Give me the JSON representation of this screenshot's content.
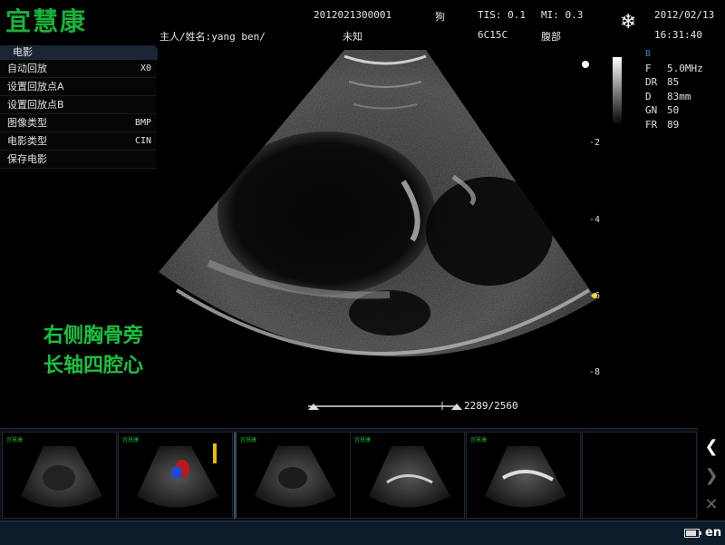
{
  "header": {
    "logo_text": "宜慧康",
    "patient_id": "2012021300001",
    "species": "狗",
    "tis": "TIS: 0.1",
    "mi": "MI: 0.3",
    "date": "2012/02/13",
    "owner_name": "主人/姓名:yang ben/",
    "unknown_label": "未知",
    "probe": "6C15C",
    "exam_preset": "腹部",
    "time": "16:31:40",
    "freeze_icon": "snowflake-icon"
  },
  "menu": {
    "title": "电影",
    "items": [
      {
        "label": "自动回放",
        "value": "X0"
      },
      {
        "label": "设置回放点A",
        "value": ""
      },
      {
        "label": "设置回放点B",
        "value": ""
      },
      {
        "label": "图像类型",
        "value": "BMP"
      },
      {
        "label": "电影类型",
        "value": "CIN"
      },
      {
        "label": "保存电影",
        "value": ""
      }
    ]
  },
  "scale": {
    "ticks": [
      "-2",
      "-4",
      "-6",
      "-8"
    ]
  },
  "params": {
    "mode": "B",
    "rows": [
      {
        "k": "F",
        "v": "5.0MHz"
      },
      {
        "k": "DR",
        "v": "85"
      },
      {
        "k": "D",
        "v": "83mm"
      },
      {
        "k": "GN",
        "v": "50"
      },
      {
        "k": "FR",
        "v": "89"
      }
    ]
  },
  "overlay": {
    "line1": "右侧胸骨旁",
    "line2": "长轴四腔心"
  },
  "cine": {
    "frame_counter": "2289/2560"
  },
  "thumbnails": {
    "count": 6,
    "thumb_logo": "宜慧康"
  },
  "navigation": {
    "prev_icon": "chevron-left-icon",
    "next_icon": "chevron-right-icon",
    "close_icon": "close-icon"
  },
  "status": {
    "language": "en",
    "battery_level": 0.85
  },
  "colors": {
    "logo_green": "#17b23a",
    "overlay_green": "#19c23f",
    "status_bar": "#0d1c2a",
    "menu_title_bg": "#1a2636"
  }
}
